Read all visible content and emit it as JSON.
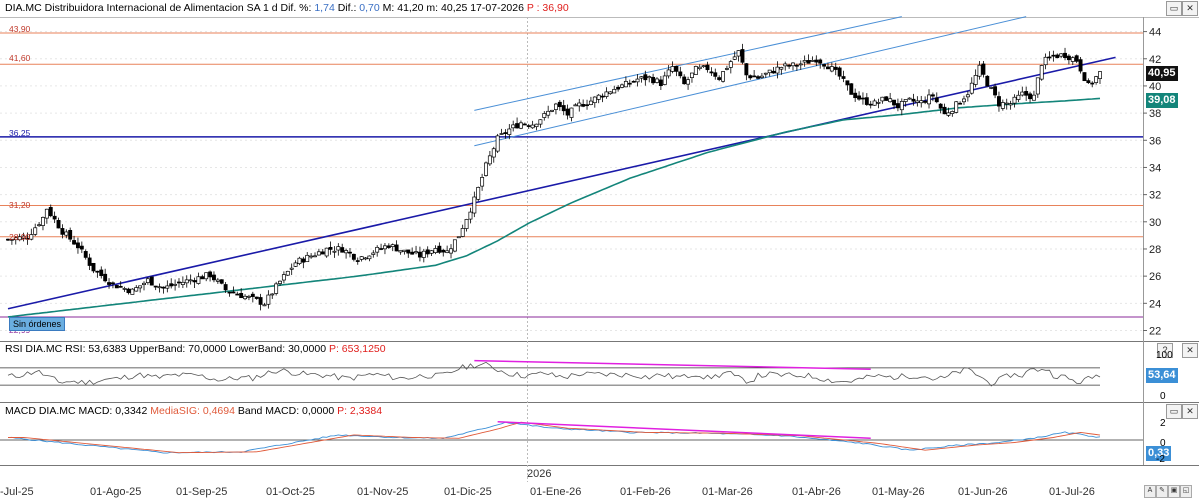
{
  "header": {
    "symbol": "DIA.MC",
    "name": "Distribuidora Internacional de Alimentacion SA",
    "interval": "1 d",
    "dif_pct_label": "Dif. %:",
    "dif_pct_value": "1,74",
    "dif_label": "Dif.:",
    "dif_value": "0,70",
    "ohlc": "M: 41,20 m: 40,25",
    "date": "17-07-2026",
    "p_label": "P : 36,90"
  },
  "window_buttons": {
    "restore": "▭",
    "close": "✕",
    "help": "?",
    "restore2": "▭",
    "close2": "✕"
  },
  "price_badges": {
    "last": "40,95",
    "ma": "39,08"
  },
  "orders_label": "Sin órdenes",
  "horizontal_levels": [
    {
      "label": "43,90",
      "value": 43.9,
      "color": "#e8825a"
    },
    {
      "label": "41,60",
      "value": 41.6,
      "color": "#e8825a"
    },
    {
      "label": "36,25",
      "value": 36.25,
      "color": "#1a1aa8"
    },
    {
      "label": "31,20",
      "value": 31.2,
      "color": "#e8825a"
    },
    {
      "label": "28,90",
      "value": 28.9,
      "color": "#e8825a"
    },
    {
      "label": "22,99",
      "value": 22.99,
      "color": "#8a2a9a"
    }
  ],
  "rsi_header": {
    "title": "RSI DIA.MC RSI: 53,6383 UpperBand: 70,0000 LowerBand: 30,0000",
    "p": "P: 653,1250"
  },
  "rsi_badge": "53,64",
  "rsi_ticks": [
    "100",
    "0"
  ],
  "macd_header": {
    "title": "MACD DIA.MC MACD: 0,3342",
    "sig": "MediaSIG: 0,4694",
    "band": "Band MACD: 0,0000",
    "p": "P: 2,3384"
  },
  "macd_badge": "0,33",
  "macd_ticks": [
    "2",
    "0",
    "-2"
  ],
  "year_label": "2026",
  "x_labels": [
    "-Jul-25",
    "01-Ago-25",
    "01-Sep-25",
    "01-Oct-25",
    "01-Nov-25",
    "01-Dic-25",
    "01-Ene-26",
    "01-Feb-26",
    "01-Mar-26",
    "01-Abr-26",
    "01-May-26",
    "01-Jun-26",
    "01-Jul-26"
  ],
  "bottom_buttons": {
    "a": "A",
    "b": "✎",
    "c": "▣",
    "d": "◱",
    "e": "✕"
  },
  "chart_data": {
    "type": "candlestick",
    "y_axis_ticks": [
      22,
      24,
      26,
      28,
      30,
      32,
      34,
      36,
      38,
      40,
      42,
      44
    ],
    "ylim": [
      21.3,
      45.0
    ],
    "months": [
      "Jul-25",
      "Ago-25",
      "Sep-25",
      "Oct-25",
      "Nov-25",
      "Dic-25",
      "Ene-26",
      "Feb-26",
      "Mar-26",
      "Abr-26",
      "May-26",
      "Jun-26",
      "Jul-26"
    ],
    "close_path_keypoints": [
      [
        0,
        28.7
      ],
      [
        5,
        28.9
      ],
      [
        9,
        30.3
      ],
      [
        10,
        31.0
      ],
      [
        14,
        29.3
      ],
      [
        18,
        28.2
      ],
      [
        22,
        26.5
      ],
      [
        27,
        25.4
      ],
      [
        32,
        24.9
      ],
      [
        36,
        25.7
      ],
      [
        40,
        25.1
      ],
      [
        44,
        25.5
      ],
      [
        48,
        25.8
      ],
      [
        52,
        26.1
      ],
      [
        56,
        25.0
      ],
      [
        60,
        24.6
      ],
      [
        64,
        24.2
      ],
      [
        66,
        24.0
      ],
      [
        70,
        25.6
      ],
      [
        74,
        27.0
      ],
      [
        78,
        27.5
      ],
      [
        82,
        28.0
      ],
      [
        86,
        28.0
      ],
      [
        90,
        27.3
      ],
      [
        94,
        27.8
      ],
      [
        98,
        28.3
      ],
      [
        102,
        27.8
      ],
      [
        106,
        27.5
      ],
      [
        110,
        28.1
      ],
      [
        113,
        27.8
      ],
      [
        116,
        29.0
      ],
      [
        120,
        31.6
      ],
      [
        123,
        34.1
      ],
      [
        126,
        36.1
      ],
      [
        129,
        36.8
      ],
      [
        132,
        37.3
      ],
      [
        135,
        37.2
      ],
      [
        138,
        37.8
      ],
      [
        141,
        38.6
      ],
      [
        144,
        37.9
      ],
      [
        147,
        38.6
      ],
      [
        150,
        38.9
      ],
      [
        153,
        39.4
      ],
      [
        156,
        39.8
      ],
      [
        159,
        40.1
      ],
      [
        162,
        40.5
      ],
      [
        165,
        40.6
      ],
      [
        168,
        40.2
      ],
      [
        171,
        41.4
      ],
      [
        174,
        40.1
      ],
      [
        177,
        41.2
      ],
      [
        180,
        41.3
      ],
      [
        183,
        40.6
      ],
      [
        186,
        41.8
      ],
      [
        188,
        42.5
      ],
      [
        190,
        40.8
      ],
      [
        193,
        40.6
      ],
      [
        196,
        41.0
      ],
      [
        199,
        41.4
      ],
      [
        202,
        41.5
      ],
      [
        205,
        41.7
      ],
      [
        208,
        42.0
      ],
      [
        211,
        41.5
      ],
      [
        214,
        40.7
      ],
      [
        217,
        39.5
      ],
      [
        220,
        38.9
      ],
      [
        223,
        38.7
      ],
      [
        226,
        39.1
      ],
      [
        229,
        38.5
      ],
      [
        232,
        38.9
      ],
      [
        235,
        38.8
      ],
      [
        238,
        39.3
      ],
      [
        241,
        37.9
      ],
      [
        244,
        38.6
      ],
      [
        247,
        39.5
      ],
      [
        250,
        41.3
      ],
      [
        252,
        40.2
      ],
      [
        255,
        38.7
      ],
      [
        258,
        38.7
      ],
      [
        261,
        39.4
      ],
      [
        264,
        39.2
      ],
      [
        266,
        41.7
      ],
      [
        269,
        42.2
      ],
      [
        272,
        42.3
      ],
      [
        275,
        41.9
      ],
      [
        278,
        40.0
      ],
      [
        281,
        40.95
      ]
    ],
    "ma_keypoints": [
      [
        0,
        23.0
      ],
      [
        30,
        24.0
      ],
      [
        60,
        25.0
      ],
      [
        90,
        26.0
      ],
      [
        110,
        26.8
      ],
      [
        118,
        27.5
      ],
      [
        126,
        28.6
      ],
      [
        134,
        29.9
      ],
      [
        145,
        31.4
      ],
      [
        160,
        33.2
      ],
      [
        180,
        35.1
      ],
      [
        200,
        36.6
      ],
      [
        215,
        37.5
      ],
      [
        230,
        37.9
      ],
      [
        245,
        38.4
      ],
      [
        260,
        38.7
      ],
      [
        272,
        38.9
      ],
      [
        281,
        39.08
      ]
    ],
    "channel_lines": [
      {
        "from": [
          120,
          38.2
        ],
        "to": [
          230,
          45.1
        ],
        "color": "#4a8fd6"
      },
      {
        "from": [
          120,
          35.6
        ],
        "to": [
          262,
          45.1
        ],
        "color": "#4a8fd6"
      },
      {
        "from": [
          0,
          23.6
        ],
        "to": [
          285,
          42.1
        ],
        "color": "#1a1aa8"
      }
    ],
    "rsi": {
      "upper": 70,
      "lower": 30,
      "last": 53.64,
      "trend_line": {
        "from": [
          120,
          87
        ],
        "to": [
          222,
          67
        ],
        "color": "#e020e0"
      }
    },
    "macd": {
      "ylim": [
        -2.6,
        2.6
      ],
      "last": 0.33,
      "trend_line": {
        "from": [
          126,
          2.15
        ],
        "to": [
          222,
          0.2
        ],
        "color": "#e020e0"
      }
    }
  }
}
